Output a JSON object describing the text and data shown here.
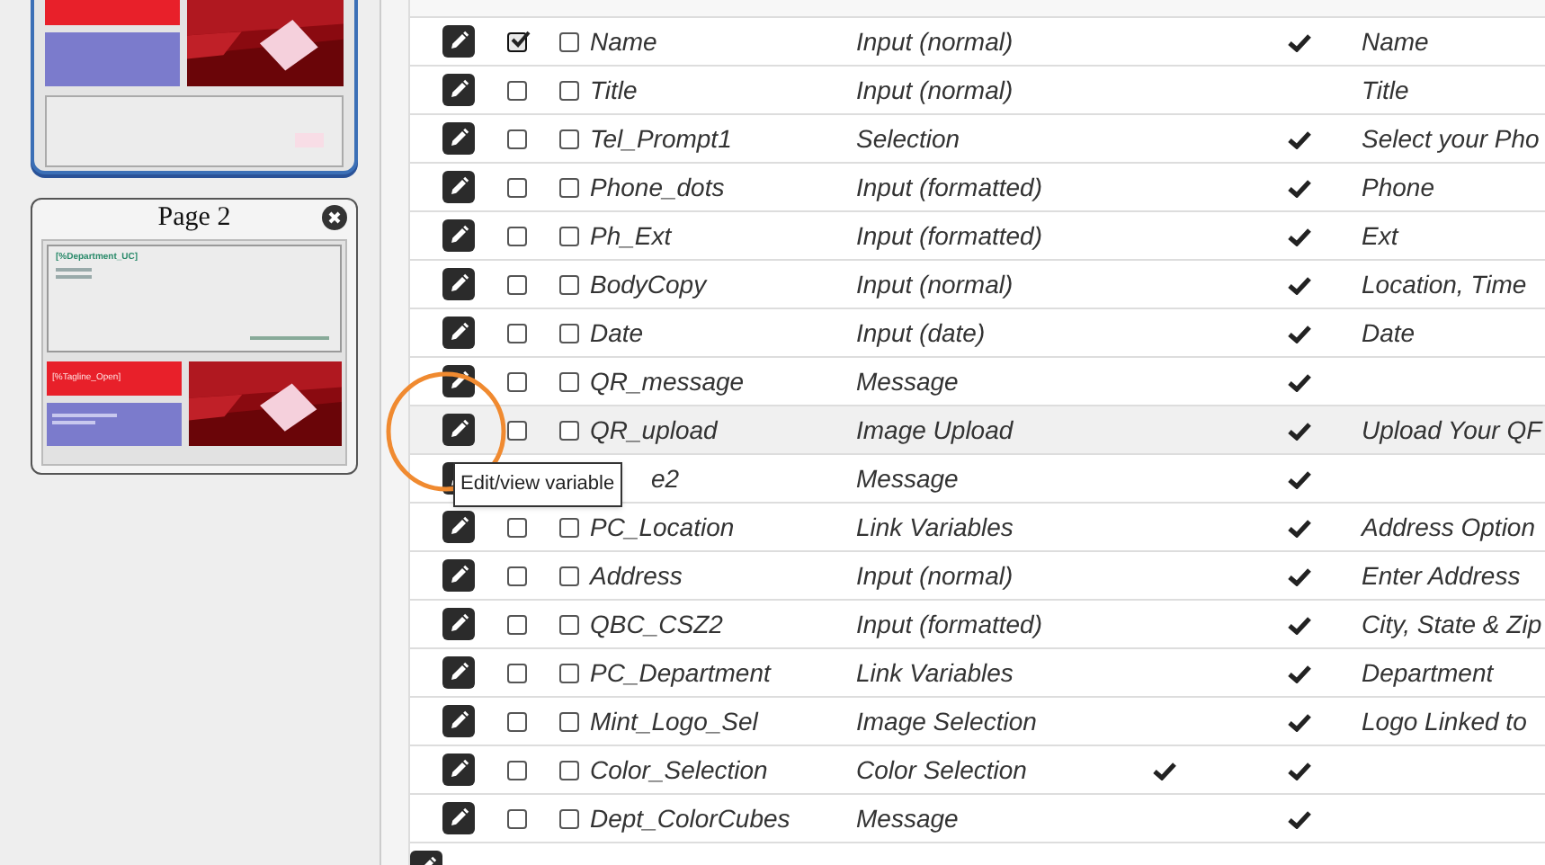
{
  "pages": [
    {
      "selected": true
    },
    {
      "title": "Page 2",
      "selected": false,
      "heading": "[%Department_UC]",
      "tagline": "[%Tagline_Open]"
    }
  ],
  "tooltip": "Edit/view variable",
  "rows": [
    {
      "name": "Name",
      "type": "Input (normal)",
      "prompt": "Name",
      "checked": true,
      "column_4": false,
      "column_5": true,
      "hovered": false,
      "occluded": false
    },
    {
      "name": "Title",
      "type": "Input (normal)",
      "prompt": "Title",
      "checked": false,
      "column_4": false,
      "column_5": false,
      "hovered": false,
      "occluded": false
    },
    {
      "name": "Tel_Prompt1",
      "type": "Selection",
      "prompt": "Select your Pho",
      "checked": false,
      "column_4": false,
      "column_5": true,
      "hovered": false,
      "occluded": false
    },
    {
      "name": "Phone_dots",
      "type": "Input (formatted)",
      "prompt": "Phone",
      "checked": false,
      "column_4": false,
      "column_5": true,
      "hovered": false,
      "occluded": false
    },
    {
      "name": "Ph_Ext",
      "type": "Input (formatted)",
      "prompt": "Ext",
      "checked": false,
      "column_4": false,
      "column_5": true,
      "hovered": false,
      "occluded": false
    },
    {
      "name": "BodyCopy",
      "type": "Input (normal)",
      "prompt": "Location, Time",
      "checked": false,
      "column_4": false,
      "column_5": true,
      "hovered": false,
      "occluded": false
    },
    {
      "name": "Date",
      "type": "Input (date)",
      "prompt": "Date",
      "checked": false,
      "column_4": false,
      "column_5": true,
      "hovered": false,
      "occluded": false
    },
    {
      "name": "QR_message",
      "type": "Message",
      "checked": false,
      "column_4": false,
      "column_5": true,
      "hovered": false,
      "occluded": false
    },
    {
      "name": "QR_upload",
      "type": "Image Upload",
      "prompt": "Upload Your QF",
      "checked": false,
      "column_4": false,
      "column_5": true,
      "hovered": true,
      "occluded": false
    },
    {
      "name": "e2",
      "type": "Message",
      "column_4": false,
      "column_5": true,
      "hovered": false,
      "occluded": true
    },
    {
      "name": "PC_Location",
      "type": "Link Variables",
      "prompt": "Address Option",
      "checked": false,
      "column_4": false,
      "column_5": true,
      "hovered": false,
      "occluded": false
    },
    {
      "name": "Address",
      "type": "Input (normal)",
      "prompt": "Enter Address",
      "checked": false,
      "column_4": false,
      "column_5": true,
      "hovered": false,
      "occluded": false
    },
    {
      "name": "QBC_CSZ2",
      "type": "Input (formatted)",
      "prompt": "City, State & Zip",
      "checked": false,
      "column_4": false,
      "column_5": true,
      "hovered": false,
      "occluded": false
    },
    {
      "name": "PC_Department",
      "type": "Link Variables",
      "prompt": "Department",
      "checked": false,
      "column_4": false,
      "column_5": true,
      "hovered": false,
      "occluded": false
    },
    {
      "name": "Mint_Logo_Sel",
      "type": "Image Selection",
      "prompt": "Logo Linked to",
      "checked": false,
      "column_4": false,
      "column_5": true,
      "hovered": false,
      "occluded": false
    },
    {
      "name": "Color_Selection",
      "type": "Color Selection",
      "checked": false,
      "column_4": true,
      "column_5": true,
      "hovered": false,
      "occluded": false
    },
    {
      "name": "Dept_ColorCubes",
      "type": "Message",
      "checked": false,
      "column_4": false,
      "column_5": true,
      "hovered": false,
      "occluded": false
    }
  ]
}
